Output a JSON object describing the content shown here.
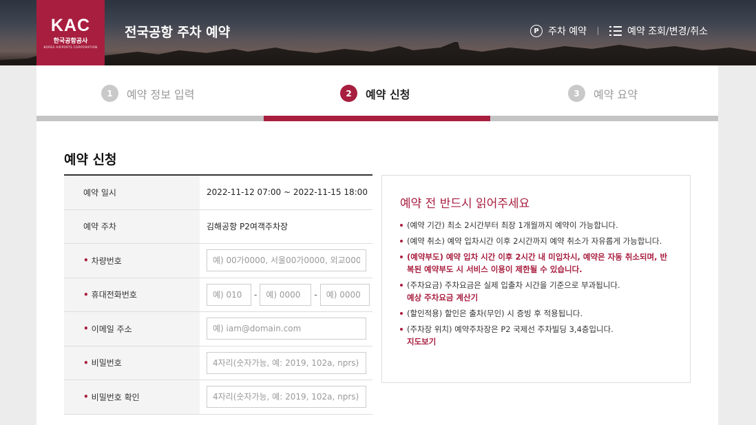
{
  "header": {
    "logo_text": "KAC",
    "logo_name": "한국공항공사",
    "logo_sub": "KOREA AIRPORTS CORPORATION",
    "title": "전국공항 주차 예약",
    "nav": [
      {
        "icon": "parking-icon",
        "label": "주차 예약"
      },
      {
        "icon": "list-icon",
        "label": "예약 조회/변경/취소"
      }
    ]
  },
  "steps": [
    {
      "num": "1",
      "label": "예약 정보 입력",
      "active": false
    },
    {
      "num": "2",
      "label": "예약 신청",
      "active": true
    },
    {
      "num": "3",
      "label": "예약 요약",
      "active": false
    }
  ],
  "section_title": "예약 신청",
  "form": {
    "reservation_datetime": {
      "label": "예약 일시",
      "value": "2022-11-12 07:00 ~ 2022-11-15 18:00"
    },
    "reservation_parking": {
      "label": "예약 주차",
      "value": "김해공항 P2여객주차장"
    },
    "car_number": {
      "label": "차량번호",
      "placeholder": "예) 00가0000, 서울00가0000, 외교000(",
      "value": ""
    },
    "phone": {
      "label": "휴대전화번호",
      "placeholder1": "예) 010",
      "placeholder2": "예) 0000",
      "placeholder3": "예) 0000",
      "separator": "-"
    },
    "email": {
      "label": "이메일 주소",
      "placeholder": "예) iam@domain.com",
      "value": ""
    },
    "password": {
      "label": "비밀번호",
      "placeholder": "4자리(숫자가능, 예: 2019, 102a, nprs)",
      "value": ""
    },
    "password_confirm": {
      "label": "비밀번호 확인",
      "placeholder": "4자리(숫자가능, 예: 2019, 102a, nprs)",
      "value": ""
    },
    "required_mark": "•"
  },
  "notice": {
    "title": "예약 전 반드시 읽어주세요",
    "items": [
      {
        "text": "(예약 기간) 최소 2시간부터 최장 1개월까지 예약이 가능합니다.",
        "warn": false
      },
      {
        "text": "(예약 취소) 예약 입차시간 이후 2시간까지 예약 취소가 자유롭게 가능합니다.",
        "warn": false
      },
      {
        "text": "(예약부도) 예약 입차 시간 이후 2시간 내 미입차시, 예약은 자동 취소되며, 반복된 예약부도 시 서비스 이용이 제한될 수 있습니다.",
        "warn": true
      },
      {
        "text": "(주차요금) 주차요금은 실제 입출차 시간을 기준으로 부과됩니다.",
        "link": "예상 주차요금 계산기",
        "warn": false
      },
      {
        "text": "(할인적용) 할인은 출차(무인) 시 증빙 후 적용됩니다.",
        "warn": false
      },
      {
        "text": "(주차장 위치) 예약주차장은 P2 국제선 주차빌딩 3,4층입니다.",
        "link": "지도보기",
        "warn": false
      }
    ]
  },
  "colors": {
    "brand": "#a81e3f",
    "step_inactive": "#c9c9c9"
  }
}
